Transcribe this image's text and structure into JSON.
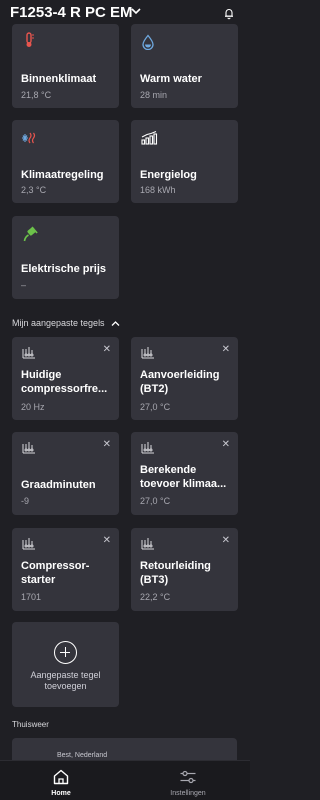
{
  "header": {
    "title": "F1253-4 R PC EM"
  },
  "tiles": [
    {
      "title": "Binnenklimaat",
      "value": "21,8 °C"
    },
    {
      "title": "Warm water",
      "value": "28 min"
    },
    {
      "title": "Klimaatregeling",
      "value": "2,3 °C"
    },
    {
      "title": "Energielog",
      "value": "168 kWh"
    },
    {
      "title": "Elektrische prijs",
      "value": "–"
    }
  ],
  "custom_section": {
    "label": "Mijn aangepaste tegels"
  },
  "custom_tiles": [
    {
      "title": "Huidige compressorfre...",
      "value": "20 Hz"
    },
    {
      "title": "Aanvoerleiding (BT2)",
      "value": "27,0 °C"
    },
    {
      "title": "Graadminuten",
      "value": "-9"
    },
    {
      "title": "Berekende toevoer klimaa...",
      "value": "27,0 °C"
    },
    {
      "title": "Compressor-starter",
      "value": "1701"
    },
    {
      "title": "Retourleiding (BT3)",
      "value": "22,2 °C"
    }
  ],
  "add_tile": {
    "label": "Aangepaste tegel toevoegen"
  },
  "weather_section": {
    "label": "Thuisweer",
    "location": "Best, Nederland"
  },
  "nav": {
    "home": "Home",
    "settings": "Instellingen"
  },
  "colors": {
    "background": "#1f1f24",
    "tile": "#34343c",
    "accent_red": "#e8554e",
    "accent_blue": "#6fa9e0",
    "accent_green": "#6cc24a"
  }
}
